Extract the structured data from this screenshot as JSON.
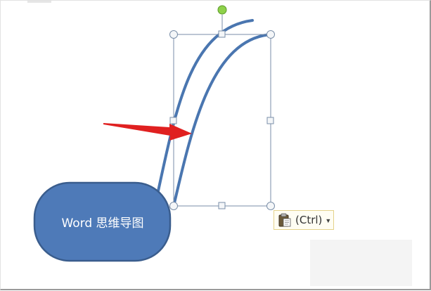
{
  "mindmap_node": {
    "label": "Word 思维导图"
  },
  "paste_options": {
    "label": "(Ctrl)",
    "icon": "clipboard-icon",
    "dropdown_icon": "caret-down-icon"
  },
  "colors": {
    "shape_fill": "#4e7ab8",
    "shape_border": "#3a5d8d",
    "curve": "#4a76b0",
    "selection_border": "#7a8ea8",
    "rotate_handle": "#8ed14a",
    "arrow": "#e02020"
  }
}
